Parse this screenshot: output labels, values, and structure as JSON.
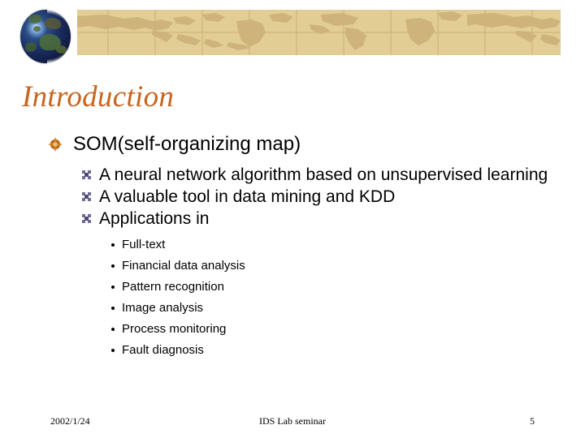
{
  "slide": {
    "title": "Introduction",
    "accent_color": "#c8641e",
    "banner_color": "#e2cd94",
    "body_text_color": "#000000"
  },
  "header": {
    "globe_icon": "globe-image",
    "banner_watermark": "world-map-watermark"
  },
  "body": {
    "level1": {
      "bullet_icon": "compass-rose-bullet-icon",
      "text": "SOM(self-organizing map)"
    },
    "level2": [
      {
        "bullet_icon": "square-grid-bullet-icon",
        "text": "A neural network algorithm based on unsupervised learning"
      },
      {
        "bullet_icon": "square-grid-bullet-icon",
        "text": "A valuable tool in data mining and KDD"
      },
      {
        "bullet_icon": "square-grid-bullet-icon",
        "text": "Applications in"
      }
    ],
    "level3": [
      {
        "bullet_icon": "round-dot-bullet-icon",
        "text": "Full-text"
      },
      {
        "bullet_icon": "round-dot-bullet-icon",
        "text": "Financial data analysis"
      },
      {
        "bullet_icon": "round-dot-bullet-icon",
        "text": "Pattern recognition"
      },
      {
        "bullet_icon": "round-dot-bullet-icon",
        "text": "Image analysis"
      },
      {
        "bullet_icon": "round-dot-bullet-icon",
        "text": "Process monitoring"
      },
      {
        "bullet_icon": "round-dot-bullet-icon",
        "text": "Fault diagnosis"
      }
    ]
  },
  "footer": {
    "date": "2002/1/24",
    "center": "IDS Lab seminar",
    "page_number": "5"
  }
}
